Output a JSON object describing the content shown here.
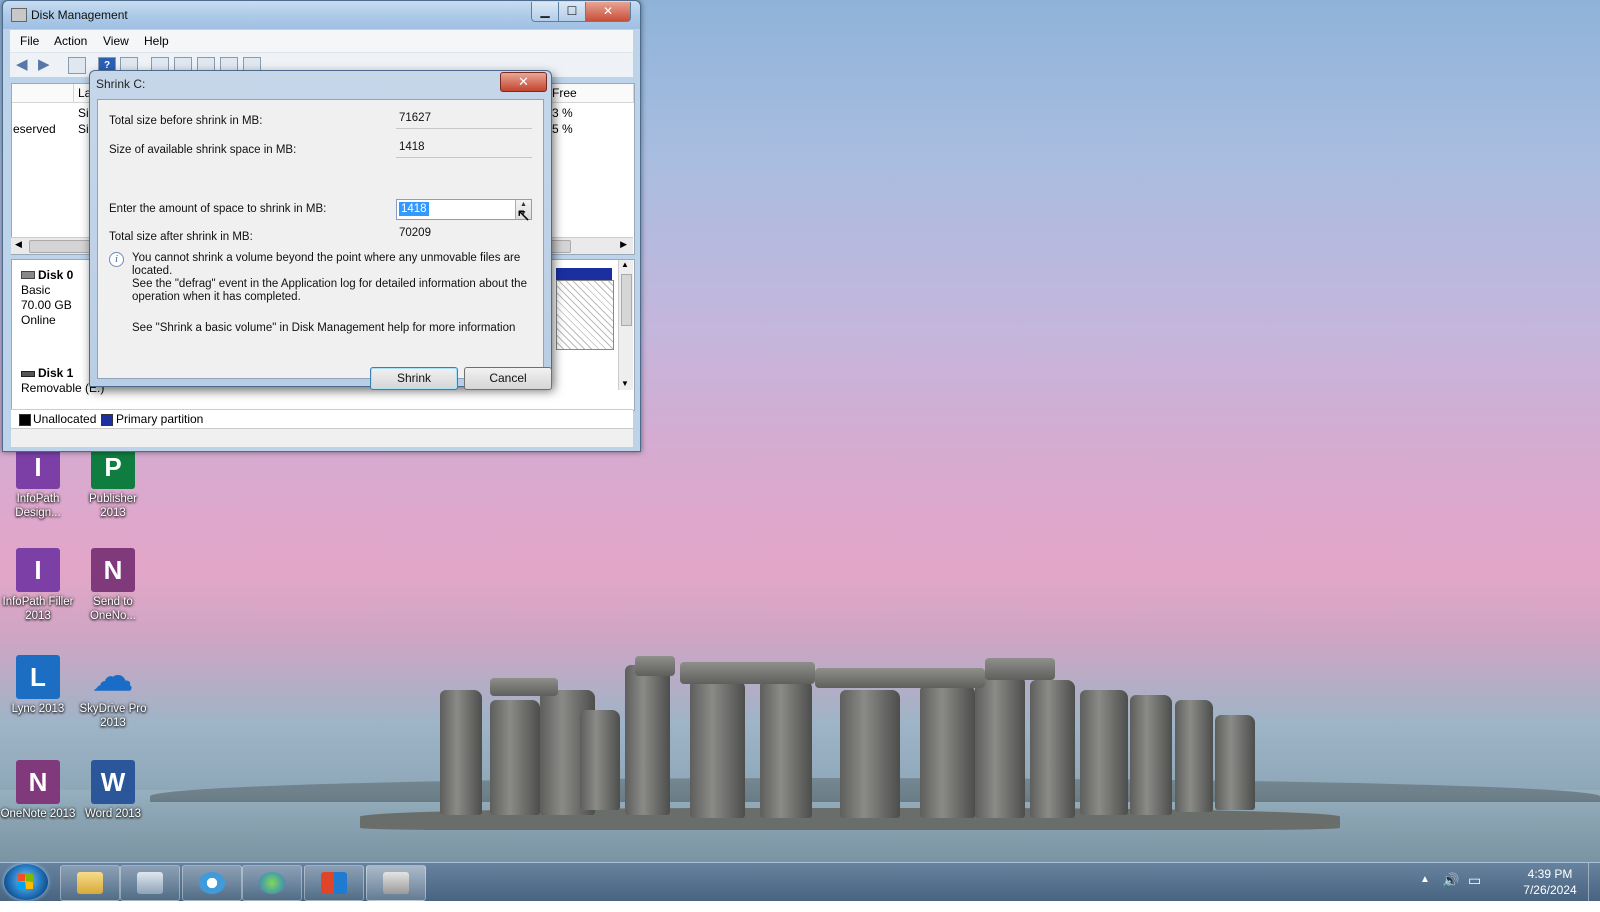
{
  "desktop": {
    "icons": [
      {
        "label": "InfoPath Design...",
        "letter": "I",
        "color": "#7b3fa6"
      },
      {
        "label": "Publisher 2013",
        "letter": "P",
        "color": "#0f7d3f"
      },
      {
        "label": "InfoPath Filler 2013",
        "letter": "I",
        "color": "#7b3fa6"
      },
      {
        "label": "Send to OneNo...",
        "letter": "N",
        "color": "#80397b"
      },
      {
        "label": "Lync 2013",
        "letter": "L",
        "color": "#1b6ec2"
      },
      {
        "label": "SkyDrive Pro 2013",
        "letter": "☁",
        "color": "#1a6dc7"
      },
      {
        "label": "OneNote 2013",
        "letter": "N",
        "color": "#80397b"
      },
      {
        "label": "Word 2013",
        "letter": "W",
        "color": "#2b579a"
      }
    ]
  },
  "disk_management": {
    "title": "Disk Management",
    "menu": [
      "File",
      "Action",
      "View",
      "Help"
    ],
    "list": {
      "col_layout_fragment": "La",
      "col_free_fragment": "Free",
      "rows": [
        {
          "name_fragment": "",
          "type_fragment": "Si",
          "free_fragment": "3 %"
        },
        {
          "name_fragment": "eserved",
          "type_fragment": "Si",
          "free_fragment": "5 %"
        }
      ]
    },
    "disks": [
      {
        "name": "Disk 0",
        "type": "Basic",
        "size": "70.00 GB",
        "status": "Online"
      },
      {
        "name": "Disk 1",
        "type": "Removable (E:)"
      }
    ],
    "legend": [
      {
        "label": "Unallocated",
        "color": "#000000"
      },
      {
        "label": "Primary partition",
        "color": "#1c2fa0"
      }
    ]
  },
  "shrink_dialog": {
    "title": "Shrink C:",
    "close": "✕",
    "fields": [
      {
        "label": "Total size before shrink in MB:",
        "value": "71627"
      },
      {
        "label": "Size of available shrink space in MB:",
        "value": "1418"
      },
      {
        "label": "Enter the amount of space to shrink in MB:",
        "value": "1418"
      },
      {
        "label": "Total size after shrink in MB:",
        "value": "70209"
      }
    ],
    "info_lines": [
      "You cannot shrink a volume beyond the point where any unmovable files are located.",
      "See the \"defrag\" event in the Application log for detailed information about the",
      "operation when it has completed."
    ],
    "help": "See \"Shrink a basic volume\" in Disk Management help for more information",
    "shrink_button": "Shrink",
    "cancel_button": "Cancel"
  },
  "taskbar": {
    "time": "4:39 PM",
    "date": "7/26/2024"
  }
}
